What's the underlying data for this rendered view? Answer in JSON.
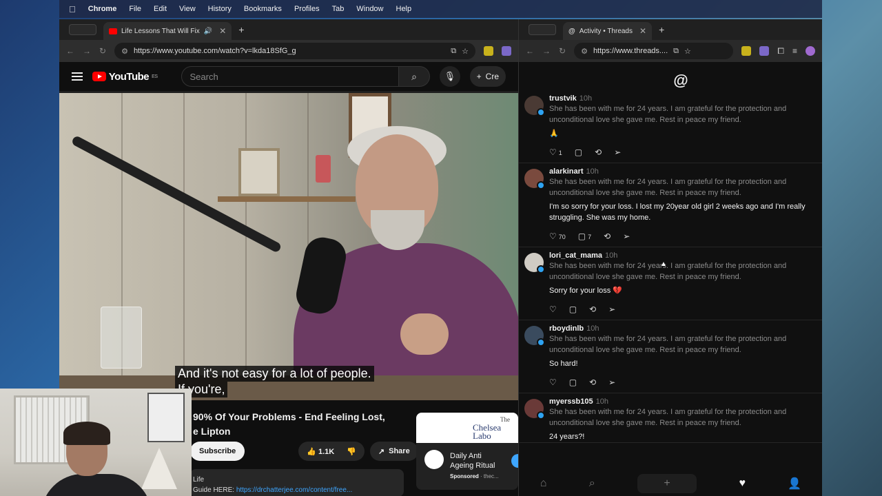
{
  "menubar": {
    "apple": "",
    "app": "Chrome",
    "items": [
      "File",
      "Edit",
      "View",
      "History",
      "Bookmarks",
      "Profiles",
      "Tab",
      "Window",
      "Help"
    ]
  },
  "yt_window": {
    "tab_title": "Life Lessons That Will Fix",
    "url": "https://www.youtube.com/watch?v=lkda18SfG_g",
    "header": {
      "logo": "YouTube",
      "region": "ES",
      "search_placeholder": "Search",
      "create_label": "Cre"
    },
    "subtitles": [
      "And it's not easy for a lot of people.",
      "If you're,"
    ],
    "video_title_lines": [
      "90% Of Your Problems - End Feeling Lost,",
      "e Lipton"
    ],
    "actions": {
      "subscribe": "Subscribe",
      "likes": "1.1K",
      "share": "Share"
    },
    "description": {
      "line1": "Life",
      "line2_prefix": "Guide HERE: ",
      "link": "https://drchatterjee.com/content/free..."
    },
    "ad": {
      "banner_top": "The",
      "banner_main": "Chelsea Labo",
      "title_lines": [
        "Daily Anti",
        "Ageing Ritual"
      ],
      "sponsored": "Sponsored",
      "sponsor_site": " · thec..."
    }
  },
  "threads_window": {
    "tab_title": "Activity • Threads",
    "url": "https://www.threads....",
    "quote": "She has been with me for 24 years. I am grateful for the protection and unconditional love she gave me. Rest in peace my friend.",
    "posts": [
      {
        "user": "trustvik",
        "time": "10h",
        "reply": "🙏",
        "likes": "1",
        "comments": ""
      },
      {
        "user": "alarkinart",
        "time": "10h",
        "reply": "I'm so sorry for your loss. I lost my 20year old girl 2 weeks ago and I'm really struggling. She was my home.",
        "likes": "70",
        "comments": "7"
      },
      {
        "user": "lori_cat_mama",
        "time": "10h",
        "reply": "Sorry for your loss 💔",
        "likes": "",
        "comments": ""
      },
      {
        "user": "rboydinlb",
        "time": "10h",
        "reply": "So hard!",
        "likes": "",
        "comments": ""
      },
      {
        "user": "myerssb105",
        "time": "10h",
        "reply": "24 years?!",
        "likes": "",
        "comments": ""
      }
    ],
    "avatar_colors": [
      "#4a3a34",
      "#7a4a3e",
      "#d0ccc4",
      "#3a4b5e",
      "#6a3a38"
    ]
  },
  "colors": {
    "yt_red": "#ff0000",
    "badge_blue": "#2ea3f2",
    "link_blue": "#3ea6ff"
  }
}
